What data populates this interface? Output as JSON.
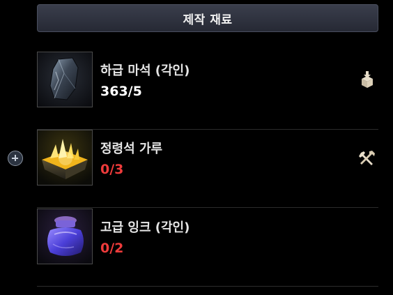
{
  "panel": {
    "title": "제작 재료"
  },
  "materials": [
    {
      "name": "하급 마석 (각인)",
      "quantity": "363/5",
      "sufficient": true,
      "icon": "dark-crystal-icon",
      "action_icon": "storage-retrieve-icon"
    },
    {
      "name": "정령석 가루",
      "quantity": "0/3",
      "sufficient": false,
      "icon": "spirit-stone-powder-icon",
      "action_icon": "craft-tools-icon"
    },
    {
      "name": "고급 잉크 (각인)",
      "quantity": "0/2",
      "sufficient": false,
      "icon": "ink-jar-icon",
      "action_icon": ""
    }
  ],
  "colors": {
    "insufficient": "#ee3b3b",
    "sufficient": "#ffffff",
    "header_bg": "#2f3340"
  },
  "side_button_icon": "plus-circle-icon"
}
